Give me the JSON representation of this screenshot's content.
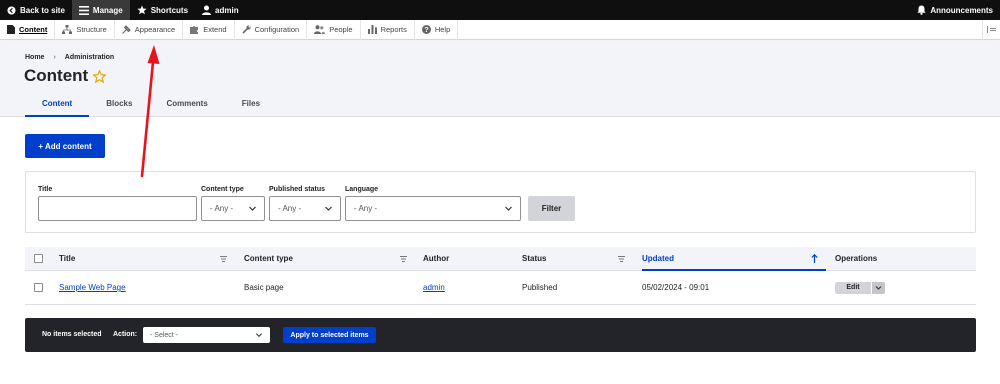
{
  "toolbar": {
    "back": "Back to site",
    "manage": "Manage",
    "shortcuts": "Shortcuts",
    "user": "admin",
    "announcements": "Announcements"
  },
  "admin_menu": {
    "items": [
      {
        "label": "Content",
        "icon": "content-icon"
      },
      {
        "label": "Structure",
        "icon": "structure-icon"
      },
      {
        "label": "Appearance",
        "icon": "appearance-icon"
      },
      {
        "label": "Extend",
        "icon": "extend-icon"
      },
      {
        "label": "Configuration",
        "icon": "configuration-icon"
      },
      {
        "label": "People",
        "icon": "people-icon"
      },
      {
        "label": "Reports",
        "icon": "reports-icon"
      },
      {
        "label": "Help",
        "icon": "help-icon"
      }
    ]
  },
  "breadcrumb": [
    "Home",
    "Administration"
  ],
  "breadcrumb_separator": "›",
  "page_title": "Content",
  "tabs": [
    "Content",
    "Blocks",
    "Comments",
    "Files"
  ],
  "add_content_label": "+ Add content",
  "filters": {
    "title_label": "Title",
    "title_value": "",
    "content_type_label": "Content type",
    "content_type_value": "- Any -",
    "published_label": "Published status",
    "published_value": "- Any -",
    "language_label": "Language",
    "language_value": "- Any -",
    "filter_button": "Filter"
  },
  "table": {
    "columns": [
      "Title",
      "Content type",
      "Author",
      "Status",
      "Updated",
      "Operations"
    ],
    "rows": [
      {
        "title": "Sample Web Page",
        "content_type": "Basic page",
        "author": "admin",
        "status": "Published",
        "updated": "05/02/2024 - 09:01",
        "operation": "Edit"
      }
    ]
  },
  "bulk": {
    "selected": "No items selected",
    "action_label": "Action:",
    "action_value": "- Select -",
    "apply": "Apply to selected items"
  },
  "colors": {
    "accent": "#003ecc",
    "annotation_arrow": "#e8141d",
    "toolbar_bg": "#0f0f0f"
  }
}
